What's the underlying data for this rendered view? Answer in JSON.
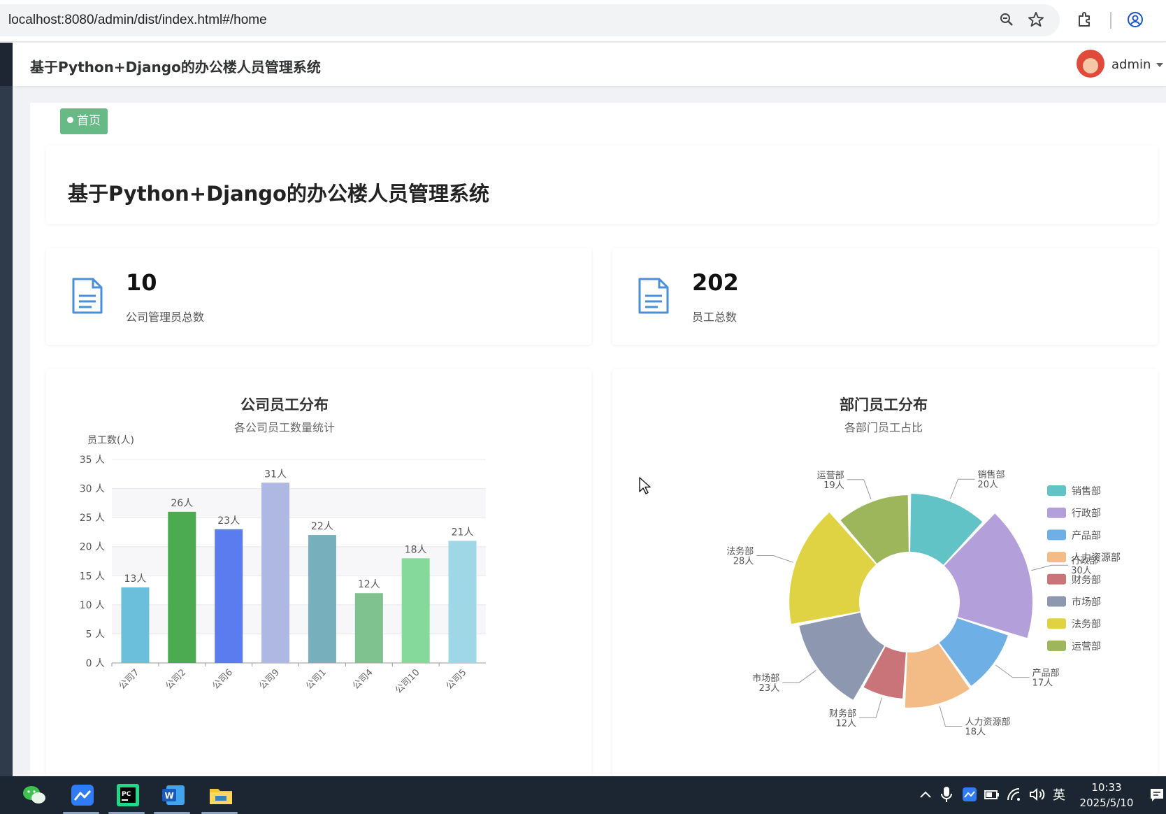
{
  "browser": {
    "url": "localhost:8080/admin/dist/index.html#/home",
    "icons": [
      "zoom-icon",
      "star-icon",
      "extensions-icon",
      "profile-icon"
    ]
  },
  "header": {
    "title": "基于Python+Django的办公楼人员管理系统",
    "user": "admin"
  },
  "tab": {
    "label": "首页"
  },
  "page_title": "基于Python+Django的办公楼人员管理系统",
  "stats": [
    {
      "value": "10",
      "label": "公司管理员总数",
      "icon": "document-icon"
    },
    {
      "value": "202",
      "label": "员工总数",
      "icon": "document-icon"
    }
  ],
  "colors": {
    "accent": "#67b986",
    "icon_blue": "#4a90d9"
  },
  "chart_data": [
    {
      "type": "bar",
      "title": "公司员工分布",
      "subtitle": "各公司员工数量统计",
      "ylabel": "员工数(人)",
      "ylim": [
        0,
        35
      ],
      "yticks": [
        0,
        5,
        10,
        15,
        20,
        25,
        30,
        35
      ],
      "ytick_suffix": " 人",
      "value_suffix": "人",
      "categories": [
        "公司7",
        "公司2",
        "公司6",
        "公司9",
        "公司1",
        "公司4",
        "公司10",
        "公司5"
      ],
      "values": [
        13,
        26,
        23,
        31,
        22,
        12,
        18,
        21
      ],
      "colors": [
        "#6bbfdb",
        "#4caa50",
        "#5b7cef",
        "#aeb8e2",
        "#78afbd",
        "#7fc18f",
        "#85d99a",
        "#a0d7e6"
      ],
      "grid": true
    },
    {
      "type": "pie",
      "title": "部门员工分布",
      "subtitle": "各部门员工占比",
      "value_suffix": "人",
      "labels": [
        "销售部",
        "行政部",
        "产品部",
        "人力资源部",
        "财务部",
        "市场部",
        "法务部",
        "运营部"
      ],
      "values": [
        20,
        30,
        17,
        18,
        12,
        23,
        28,
        19
      ],
      "colors": [
        "#62c3c6",
        "#b3a0da",
        "#6eb0e5",
        "#f3bb85",
        "#c97478",
        "#8d98b0",
        "#e0d343",
        "#9db65c"
      ],
      "legend": "right"
    }
  ],
  "taskbar": {
    "apps": [
      "wechat-icon",
      "feishu-icon",
      "pycharm-icon",
      "word-icon",
      "file-explorer-icon"
    ],
    "ime": "英",
    "time": "10:33",
    "date": "2025/5/10"
  }
}
